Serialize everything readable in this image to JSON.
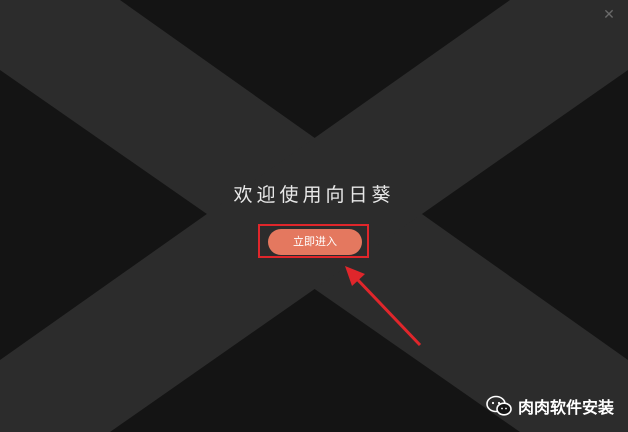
{
  "window": {
    "close_glyph": "✕",
    "welcome_text": "欢迎使用向日葵",
    "enter_button_label": "立即进入"
  },
  "watermark": {
    "icon": "wechat-icon",
    "text": "肉肉软件安装"
  },
  "colors": {
    "background_dark": "#141414",
    "band_gray": "#2c2c2c",
    "button_orange": "#e4785f",
    "highlight_red": "#e0262b"
  }
}
